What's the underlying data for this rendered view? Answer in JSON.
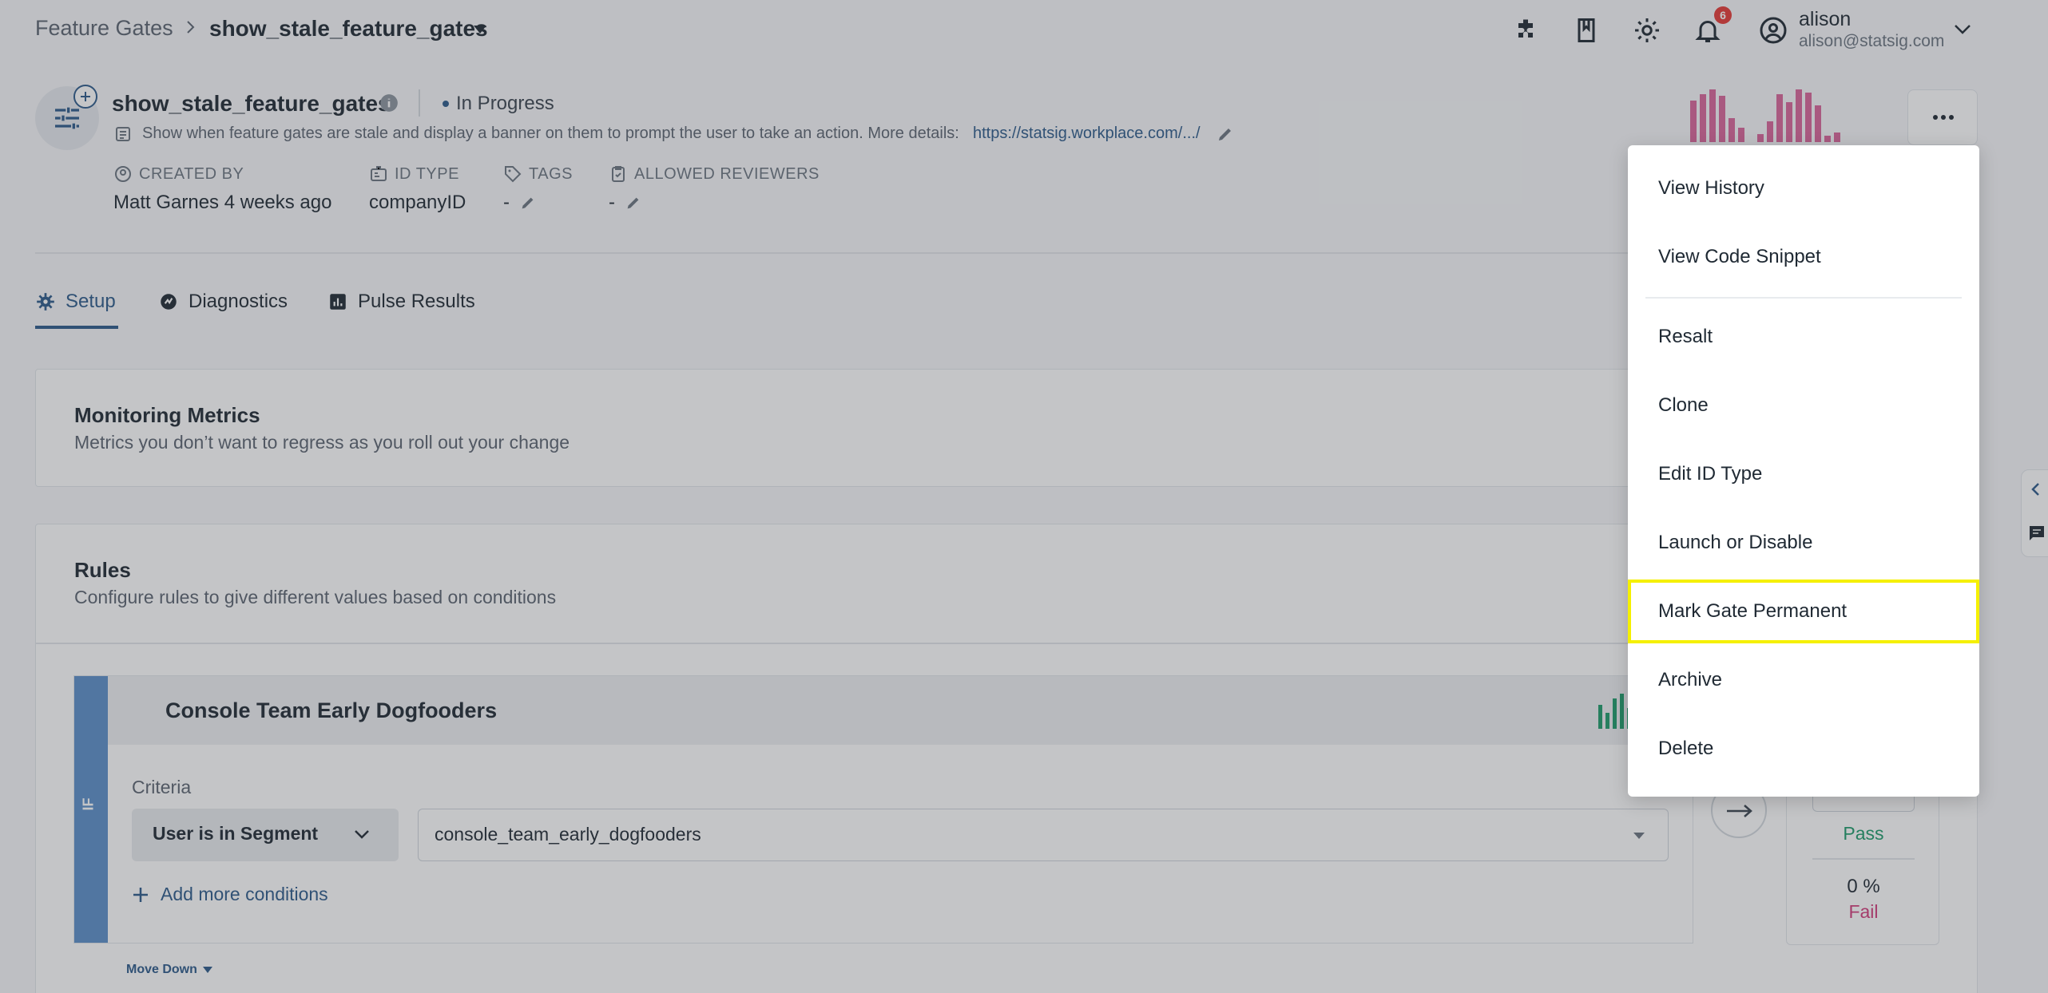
{
  "breadcrumb": {
    "root": "Feature Gates",
    "current": "show_stale_feature_gates"
  },
  "topbar": {
    "notification_count": "6",
    "user_name": "alison",
    "user_email": "alison@statsig.com"
  },
  "gate": {
    "title": "show_stale_feature_gates",
    "status": "In Progress",
    "description": "Show when feature gates are stale and display a banner on them to prompt the user to take an action. More details:",
    "description_link": "https://statsig.workplace.com/.../"
  },
  "meta": {
    "created_by_label": "CREATED BY",
    "created_by_value": "Matt Garnes 4 weeks ago",
    "id_type_label": "ID TYPE",
    "id_type_value": "companyID",
    "tags_label": "TAGS",
    "tags_value": "-",
    "reviewers_label": "ALLOWED REVIEWERS",
    "reviewers_value": "-"
  },
  "tabs": [
    {
      "label": "Setup",
      "active": true
    },
    {
      "label": "Diagnostics",
      "active": false
    },
    {
      "label": "Pulse Results",
      "active": false
    }
  ],
  "monitoring": {
    "title": "Monitoring Metrics",
    "subtitle": "Metrics you don’t want to regress as you roll out your change"
  },
  "rules": {
    "title": "Rules",
    "subtitle": "Configure rules to give different values based on conditions",
    "rule": {
      "if_label": "IF",
      "name": "Console Team Early Dogfooders",
      "criteria_label": "Criteria",
      "condition_type": "User is in Segment",
      "segment": "console_team_early_dogfooders",
      "add_conditions": "Add more conditions",
      "pass_label": "Pass",
      "fail_pct": "0 %",
      "fail_label": "Fail"
    },
    "move_down": "Move Down"
  },
  "menu": {
    "items": [
      "View History",
      "View Code Snippet",
      "Resalt",
      "Clone",
      "Edit ID Type",
      "Launch or Disable",
      "Mark Gate Permanent",
      "Archive",
      "Delete"
    ],
    "highlighted": "Mark Gate Permanent"
  },
  "colors": {
    "accent": "#2c5a8a",
    "highlight": "#f5f000",
    "pass": "#1e9b6a",
    "fail": "#d13b7a"
  }
}
